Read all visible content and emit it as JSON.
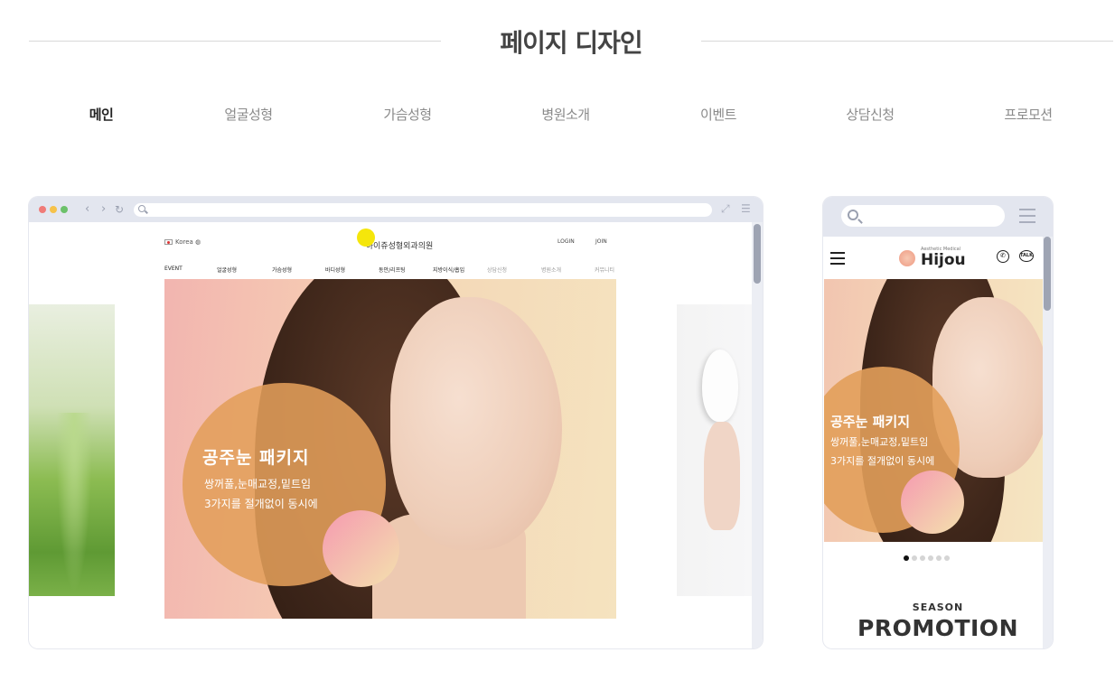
{
  "section": {
    "title": "페이지 디자인"
  },
  "tabs": [
    {
      "label": "메인",
      "active": true
    },
    {
      "label": "얼굴성형",
      "active": false
    },
    {
      "label": "가슴성형",
      "active": false
    },
    {
      "label": "병원소개",
      "active": false
    },
    {
      "label": "이벤트",
      "active": false
    },
    {
      "label": "상담신청",
      "active": false
    },
    {
      "label": "프로모션",
      "active": false
    }
  ],
  "desktop_mockup": {
    "site": {
      "region": "Korea",
      "logo": "하이쥬성형외과의원",
      "login": "LOGIN",
      "join": "JOIN",
      "menu": [
        "EVENT",
        "얼굴성형",
        "가슴성형",
        "바디성형",
        "동안/리프팅",
        "지방이식/흡입",
        "상담신청",
        "병원소개",
        "커뮤니티"
      ]
    },
    "hero": {
      "title": "공주눈 패키지",
      "sub1": "쌍꺼풀,눈매교정,밑트임",
      "sub2": "3가지를 절개없이 동시에"
    }
  },
  "mobile_mockup": {
    "logo_tagline": "Aesthetic Medical",
    "logo": "Hijou",
    "talk_icon_label": "TALK",
    "hero": {
      "title": "공주눈 패키지",
      "sub1": "쌍꺼풀,눈매교정,밑트임",
      "sub2": "3가지를 절개없이 동시에"
    },
    "carousel": {
      "total": 6,
      "active": 1
    },
    "season": "SEASON",
    "promotion": "PROMOTION"
  },
  "colors": {
    "accent_orange": "#e29e5a",
    "chrome_gray": "#e3e6ef",
    "highlight_yellow": "#f5e60b"
  },
  "icons": [
    "search-icon",
    "menu-icon",
    "hamburger-icon",
    "whatsapp-icon",
    "kakaotalk-icon",
    "expand-icon",
    "reload-icon"
  ]
}
